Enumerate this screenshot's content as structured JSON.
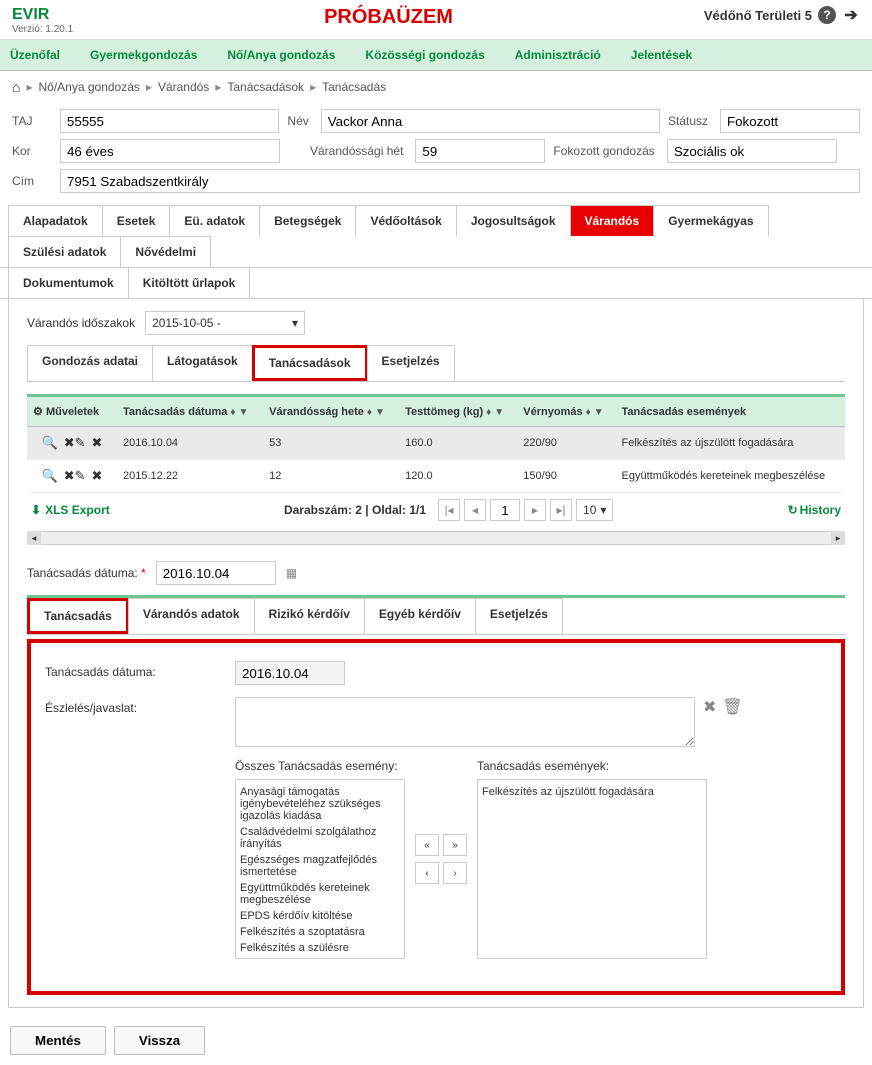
{
  "header": {
    "app_name": "EVIR",
    "version_label": "Verzió: 1.20.1",
    "mode": "PRÓBAÜZEM",
    "user": "Védőnő Területi 5",
    "help_glyph": "?",
    "logout_glyph": "➔"
  },
  "main_nav": [
    "Üzenőfal",
    "Gyermekgondozás",
    "Nő/Anya gondozás",
    "Közösségi gondozás",
    "Adminisztráció",
    "Jelentések"
  ],
  "breadcrumb": {
    "items": [
      "Nő/Anya gondozás",
      "Várandós",
      "Tanácsadások",
      "Tanácsadás"
    ]
  },
  "patient": {
    "taj_label": "TAJ",
    "taj": "55555",
    "nev_label": "Név",
    "nev": "Vackor Anna",
    "status_label": "Státusz",
    "status": "Fokozott",
    "kor_label": "Kor",
    "kor": "46 éves",
    "het_label": "Várandóssági hét",
    "het": "59",
    "gondozas_label": "Fokozott gondozás",
    "gondozas": "Szociális ok",
    "cim_label": "Cím",
    "cim": "7951 Szabadszentkirály"
  },
  "tabs_main": [
    "Alapadatok",
    "Esetek",
    "Eü. adatok",
    "Betegségek",
    "Védőoltások",
    "Jogosultságok",
    "Várandós",
    "Gyermekágyas",
    "Szülési adatok",
    "Nővédelmi"
  ],
  "tabs_row2": [
    "Dokumentumok",
    "Kitöltött űrlapok"
  ],
  "period": {
    "label": "Várandós időszakok",
    "value": "2015-10-05 -"
  },
  "sub_tabs": [
    "Gondozás adatai",
    "Látogatások",
    "Tanácsadások",
    "Esetjelzés"
  ],
  "table": {
    "headers": [
      "Műveletek",
      "Tanácsadás dátuma",
      "Várandósság hete",
      "Testtömeg (kg)",
      "Vérnyomás",
      "Tanácsadás események"
    ],
    "rows": [
      {
        "date": "2016.10.04",
        "week": "53",
        "weight": "160.0",
        "bp": "220/90",
        "event": "Felkészítés az újszülött fogadására"
      },
      {
        "date": "2015.12.22",
        "week": "12",
        "weight": "120.0",
        "bp": "150/90",
        "event": "Együttműködés kereteinek megbeszélése"
      }
    ],
    "footer": {
      "xls": "XLS Export",
      "count_text": "Darabszám: 2 | Oldal: 1/1",
      "page": "1",
      "page_size": "10",
      "history": "History"
    }
  },
  "detail": {
    "date_label": "Tanácsadás dátuma:",
    "date_value": "2016.10.04",
    "tabs": [
      "Tanácsadás",
      "Várandós adatok",
      "Rizikó kérdőív",
      "Egyéb kérdőív",
      "Esetjelzés"
    ],
    "form": {
      "date_label": "Tanácsadás dátuma:",
      "date_value": "2016.10.04",
      "obs_label": "Észlelés/javaslat:",
      "all_events_label": "Összes Tanácsadás esemény:",
      "sel_events_label": "Tanácsadás események:",
      "all_events": [
        "Anyasági támogatás igénybevételéhez szükséges igazolás kiadása",
        "Családvédelmi szolgálathoz irányítás",
        "Egészséges magzatfejlődés ismertetése",
        "Együttműködés kereteinek megbeszélése",
        "EPDS kérdőív kitöltése",
        "Felkészítés a szoptatásra",
        "Felkészítés a szülésre"
      ],
      "sel_events": [
        "Felkészítés az újszülött fogadására"
      ]
    }
  },
  "footer_buttons": {
    "save": "Mentés",
    "back": "Vissza"
  }
}
